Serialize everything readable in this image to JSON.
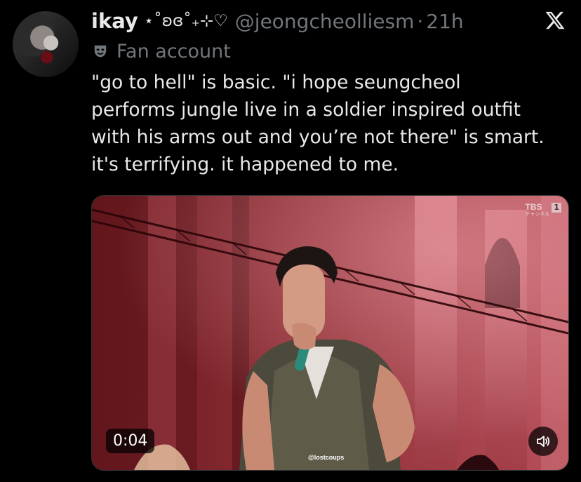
{
  "tweet": {
    "author_name": "ikay",
    "author_deco": "⋆˚ʚɞ˚₊⊹♡",
    "handle": "@jeongcheolliesm",
    "separator": "·",
    "time": "21h",
    "account_label": "Fan account",
    "text_lines": [
      "\"go to hell\" is basic. \"i hope seungcheol",
      "performs jungle live in a soldier inspired outfit",
      "with his arms out and you’re not there\" is smart.",
      "it's terrifying. it happened to me."
    ]
  },
  "video": {
    "duration": "0:04",
    "watermark": "@lostcoups",
    "channel_logo": "TBS",
    "channel_sub": "チャンネル",
    "channel_number": "1"
  },
  "icons": {
    "platform": "x-logo-icon",
    "label": "mask-icon",
    "sound": "speaker-icon"
  },
  "colors": {
    "background": "#000000",
    "text_primary": "#e7e9ea",
    "text_secondary": "#71767b"
  }
}
